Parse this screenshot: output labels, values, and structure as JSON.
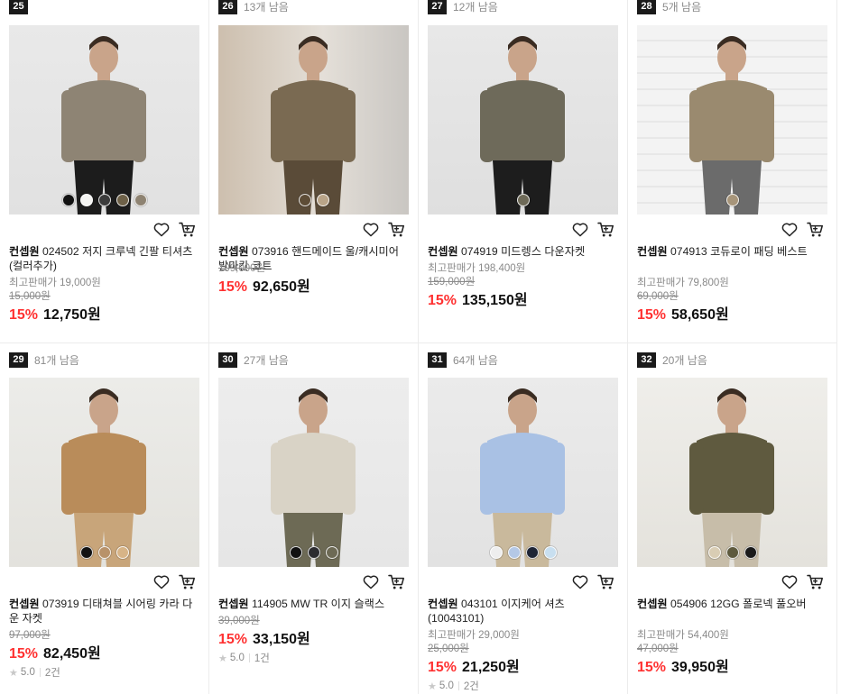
{
  "colors": {
    "discount": "#ff3131",
    "rank_bg": "#1a1a1a",
    "muted": "#8a8a8a"
  },
  "products": [
    {
      "rank": "25",
      "stock": "",
      "brand": "컨셉원",
      "name": "024502 저지 크루넥 긴팔 티셔츠 (컬러추가)",
      "max_price": "최고판매가 19,000원",
      "original": "15,000원",
      "discount": "15%",
      "price": "12,750원",
      "rating": "",
      "reviews": "",
      "swatches": [
        "#111111",
        "#f4f4f2",
        "#3b3b3b",
        "#6e6148",
        "#8e8372"
      ]
    },
    {
      "rank": "26",
      "stock": "13개 남음",
      "brand": "컨셉원",
      "name": "073916 핸드메이드 울/캐시미어 발마칸 코트",
      "max_price": "",
      "original": "109,000원",
      "discount": "15%",
      "price": "92,650원",
      "rating": "",
      "reviews": "",
      "swatches": [
        "#5d4c36",
        "#b9a488"
      ]
    },
    {
      "rank": "27",
      "stock": "12개 남음",
      "brand": "컨셉원",
      "name": "074919 미드렝스 다운자켓",
      "max_price": "최고판매가 198,400원",
      "original": "159,000원",
      "discount": "15%",
      "price": "135,150원",
      "rating": "",
      "reviews": "",
      "swatches": [
        "#6e6a58"
      ]
    },
    {
      "rank": "28",
      "stock": "5개 남음",
      "brand": "컨셉원",
      "name": "074913 코듀로이 패딩 베스트",
      "max_price": "최고판매가 79,800원",
      "original": "69,000원",
      "discount": "15%",
      "price": "58,650원",
      "rating": "",
      "reviews": "",
      "swatches": [
        "#a7957a"
      ]
    },
    {
      "rank": "29",
      "stock": "81개 남음",
      "brand": "컨셉원",
      "name": "073919 디태쳐블 시어링 카라 다운 자켓",
      "max_price": "",
      "original": "97,000원",
      "discount": "15%",
      "price": "82,450원",
      "rating": "5.0",
      "reviews": "2건",
      "swatches": [
        "#121212",
        "#b8926a",
        "#d7b487"
      ]
    },
    {
      "rank": "30",
      "stock": "27개 남음",
      "brand": "컨셉원",
      "name": "114905 MW TR 이지 슬랙스",
      "max_price": "",
      "original": "39,000원",
      "discount": "15%",
      "price": "33,150원",
      "rating": "5.0",
      "reviews": "1건",
      "swatches": [
        "#111111",
        "#2c2c30",
        "#6d6a55"
      ]
    },
    {
      "rank": "31",
      "stock": "64개 남음",
      "brand": "컨셉원",
      "name": "043101 이지케어 셔츠 (10043101)",
      "max_price": "최고판매가 29,000원",
      "original": "25,000원",
      "discount": "15%",
      "price": "21,250원",
      "rating": "5.0",
      "reviews": "2건",
      "swatches": [
        "#eeeeee",
        "#b4c8e6",
        "#1e2535",
        "#c8dff0"
      ]
    },
    {
      "rank": "32",
      "stock": "20개 남음",
      "brand": "컨셉원",
      "name": "054906 12GG 폴로넥 풀오버",
      "max_price": "최고판매가 54,400원",
      "original": "47,000원",
      "discount": "15%",
      "price": "39,950원",
      "rating": "",
      "reviews": "",
      "swatches": [
        "#d9cdb4",
        "#5e5a3e",
        "#1a1a1a"
      ]
    }
  ]
}
